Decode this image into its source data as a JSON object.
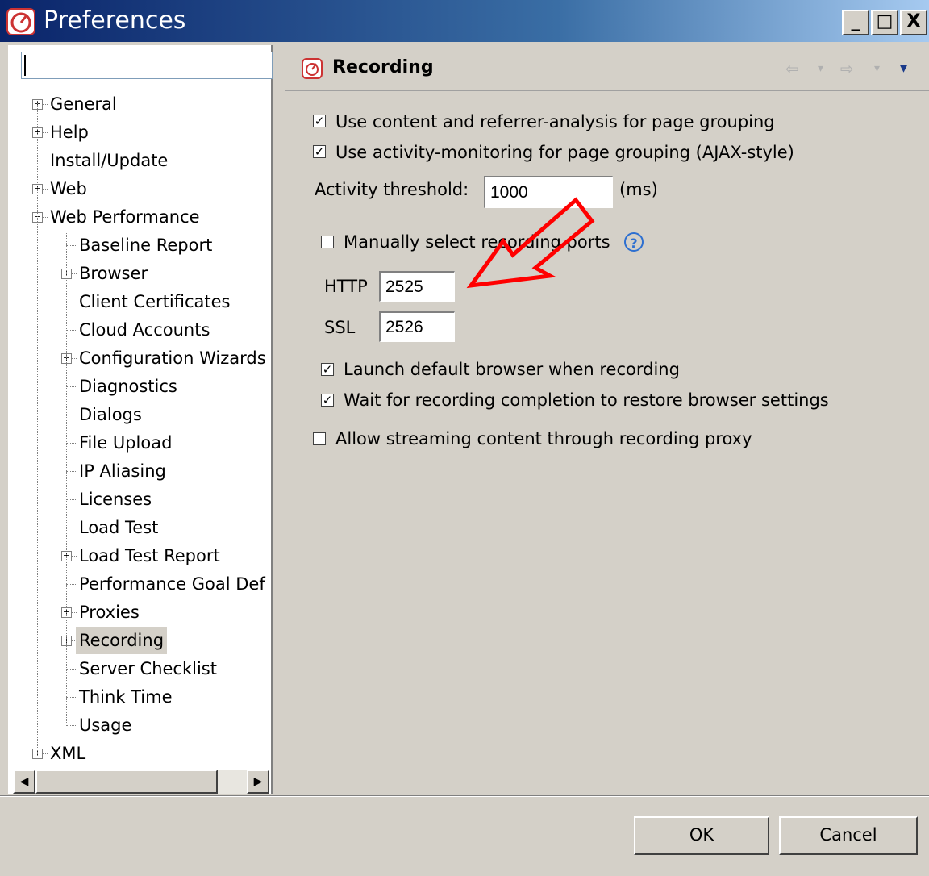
{
  "window": {
    "title": "Preferences",
    "controls": {
      "minimize": "_",
      "maximize": "□",
      "close": "X"
    }
  },
  "filter": {
    "value": ""
  },
  "tree": [
    {
      "label": "General",
      "level": 0,
      "expander": "plus"
    },
    {
      "label": "Help",
      "level": 0,
      "expander": "plus"
    },
    {
      "label": "Install/Update",
      "level": 0,
      "expander": "none"
    },
    {
      "label": "Web",
      "level": 0,
      "expander": "plus"
    },
    {
      "label": "Web Performance",
      "level": 0,
      "expander": "minus"
    },
    {
      "label": "Baseline Report",
      "level": 1,
      "expander": "none"
    },
    {
      "label": "Browser",
      "level": 1,
      "expander": "plus"
    },
    {
      "label": "Client Certificates",
      "level": 1,
      "expander": "none"
    },
    {
      "label": "Cloud Accounts",
      "level": 1,
      "expander": "none"
    },
    {
      "label": "Configuration Wizards",
      "level": 1,
      "expander": "plus"
    },
    {
      "label": "Diagnostics",
      "level": 1,
      "expander": "none"
    },
    {
      "label": "Dialogs",
      "level": 1,
      "expander": "none"
    },
    {
      "label": "File Upload",
      "level": 1,
      "expander": "none"
    },
    {
      "label": "IP Aliasing",
      "level": 1,
      "expander": "none"
    },
    {
      "label": "Licenses",
      "level": 1,
      "expander": "none"
    },
    {
      "label": "Load Test",
      "level": 1,
      "expander": "none"
    },
    {
      "label": "Load Test Report",
      "level": 1,
      "expander": "plus"
    },
    {
      "label": "Performance Goal Def",
      "level": 1,
      "expander": "none"
    },
    {
      "label": "Proxies",
      "level": 1,
      "expander": "plus"
    },
    {
      "label": "Recording",
      "level": 1,
      "expander": "plus",
      "selected": true
    },
    {
      "label": "Server Checklist",
      "level": 1,
      "expander": "none"
    },
    {
      "label": "Think Time",
      "level": 1,
      "expander": "none"
    },
    {
      "label": "Usage",
      "level": 1,
      "expander": "none"
    },
    {
      "label": "XML",
      "level": 0,
      "expander": "plus"
    }
  ],
  "page": {
    "title": "Recording",
    "nav": {
      "back": "⇦",
      "back_menu": "▾",
      "forward": "⇨",
      "forward_menu": "▾",
      "view_menu": "▾"
    },
    "options": {
      "content_analysis": {
        "label": "Use content and referrer-analysis for page grouping",
        "checked": true
      },
      "activity_monitoring": {
        "label": "Use activity-monitoring for page grouping (AJAX-style)",
        "checked": true
      },
      "activity_threshold": {
        "label": "Activity threshold:",
        "value": "1000",
        "unit": "(ms)"
      },
      "manual_ports": {
        "label": "Manually select recording ports",
        "checked": false
      },
      "http_port": {
        "label": "HTTP",
        "value": "2525"
      },
      "ssl_port": {
        "label": "SSL",
        "value": "2526"
      },
      "launch_browser": {
        "label": "Launch default browser when recording",
        "checked": true
      },
      "wait_completion": {
        "label": "Wait for recording completion to restore browser settings",
        "checked": true
      },
      "allow_streaming": {
        "label": "Allow streaming content through recording proxy",
        "checked": false
      }
    },
    "help_glyph": "?"
  },
  "buttons": {
    "ok": "OK",
    "cancel": "Cancel"
  },
  "colors": {
    "titlebar_start": "#0a246a",
    "titlebar_end": "#a6caf0",
    "annotation_arrow": "#ff0000",
    "help": "#2d6fd0"
  }
}
